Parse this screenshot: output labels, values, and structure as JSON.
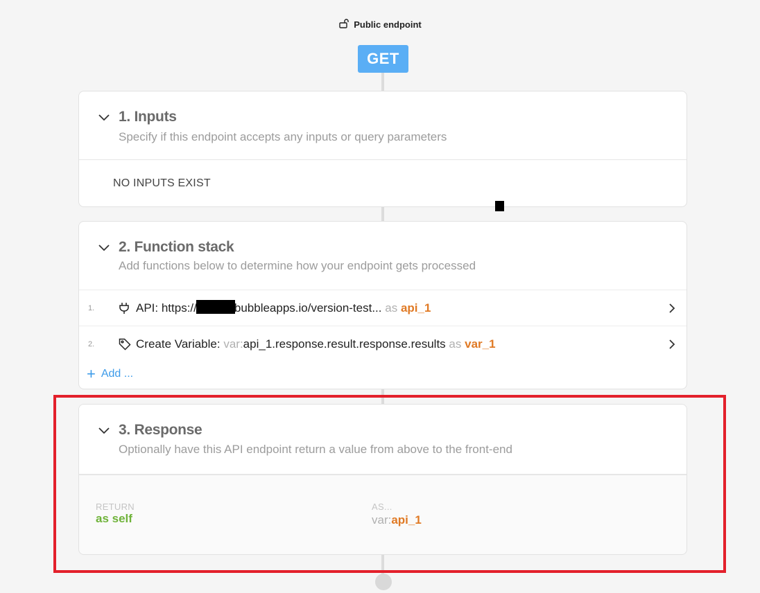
{
  "endpoint": {
    "visibility_label": "Public endpoint",
    "visibility_icon": "unlocked-lock-icon",
    "method": "GET",
    "method_color": "#5aaef5"
  },
  "sections": {
    "inputs": {
      "title": "1. Inputs",
      "subtitle": "Specify if this endpoint accepts any inputs or query parameters",
      "empty_text": "NO INPUTS EXIST"
    },
    "function_stack": {
      "title": "2. Function stack",
      "subtitle": "Add functions below to determine how your endpoint gets processed",
      "items": [
        {
          "number": "1.",
          "icon": "plug-icon",
          "label_prefix": "API: https://",
          "label_suffix": "bubbleapps.io/version-test...",
          "as_word": "as",
          "alias": "api_1"
        },
        {
          "number": "2.",
          "icon": "tag-icon",
          "label_prefix": "Create Variable:",
          "var_prefix": "var:",
          "value": "api_1.response.result.response.results",
          "as_word": "as",
          "alias": "var_1"
        }
      ],
      "add_label": "Add ..."
    },
    "response": {
      "title": "3. Response",
      "subtitle": "Optionally have this API endpoint return a value from above to the front-end",
      "return_label": "RETURN",
      "return_value": "as self",
      "as_label": "AS...",
      "as_prefix": "var:",
      "as_value": "api_1"
    }
  },
  "colors": {
    "accent_orange": "#e07a25",
    "accent_green": "#6fb33a",
    "link_blue": "#3d9be9",
    "highlight_red": "#e3202b"
  }
}
